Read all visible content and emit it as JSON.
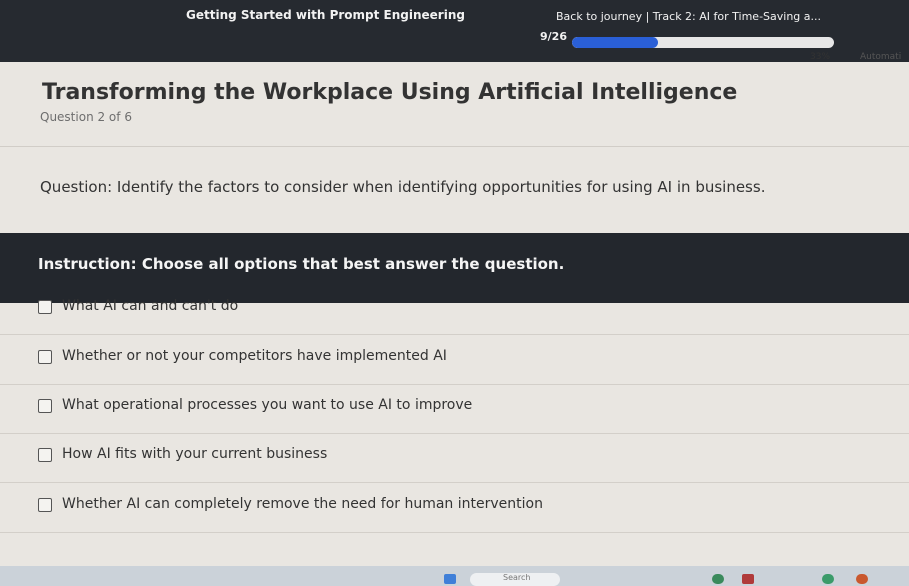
{
  "header": {
    "course_title": "Getting Started with Prompt Engineering",
    "journey_link": "Back to journey  |  Track 2: AI for Time-Saving a...",
    "progress_count": "9/26",
    "progress_fraction": 0.33,
    "progress_percent": "33%",
    "auto_label": "Automati"
  },
  "page": {
    "title": "Transforming the Workplace Using Artificial Intelligence",
    "question_count": "Question 2 of 6"
  },
  "question": {
    "text": "Question: Identify the factors to consider when identifying opportunities for using AI in business."
  },
  "instruction": {
    "text": "Instruction: Choose all options that best answer the question."
  },
  "options": [
    {
      "label": "What AI can and can't do",
      "checked": false
    },
    {
      "label": "Whether or not your competitors have implemented AI",
      "checked": false
    },
    {
      "label": "What operational processes you want to use AI to improve",
      "checked": false
    },
    {
      "label": "How AI fits with your current business",
      "checked": false
    },
    {
      "label": "Whether AI can completely remove the need for human intervention",
      "checked": false
    }
  ],
  "taskbar": {
    "search_label": "Search"
  },
  "colors": {
    "dark_header": "#262a30",
    "instruction_bg": "#23272d",
    "progress_accent": "#2a5fd6",
    "page_bg": "#e9e6e1"
  }
}
